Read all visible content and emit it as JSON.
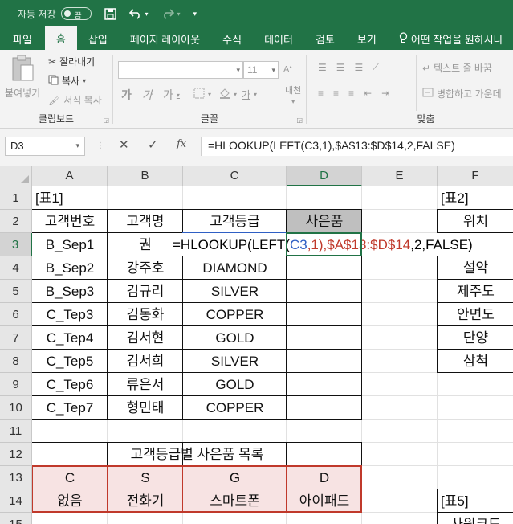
{
  "titlebar": {
    "autosave_label": "자동 저장",
    "autosave_state": "끔",
    "icons": [
      "save-icon",
      "undo-icon",
      "redo-icon",
      "customize-qat-icon"
    ]
  },
  "tabs": [
    "파일",
    "홈",
    "삽입",
    "페이지 레이아웃",
    "수식",
    "데이터",
    "검토",
    "보기"
  ],
  "active_tab": "홈",
  "tell_me": "어떤 작업을 원하시나",
  "ribbon": {
    "clipboard": {
      "paste": "붙여넣기",
      "cut": "잘라내기",
      "copy": "복사",
      "format_painter": "서식 복사",
      "group_label": "클립보드"
    },
    "font": {
      "font_name": "",
      "font_size": "11",
      "bold": "가",
      "italic": "가",
      "underline": "가",
      "phonetic": "내천",
      "group_label": "글꼴"
    },
    "alignment": {
      "wrap_text": "텍스트 줄 바꿈",
      "merge_center": "병합하고 가운데",
      "group_label": "맞춤"
    }
  },
  "formula_bar": {
    "name_box": "D3",
    "fx": "fx",
    "formula": "=HLOOKUP(LEFT(C3,1),$A$13:$D$14,2,FALSE)"
  },
  "columns": [
    "A",
    "B",
    "C",
    "D",
    "E",
    "F"
  ],
  "selected_column": "D",
  "rows": [
    "1",
    "2",
    "3",
    "4",
    "5",
    "6",
    "7",
    "8",
    "9",
    "10",
    "11",
    "12",
    "13",
    "14",
    "15"
  ],
  "selected_row": "3",
  "cells": {
    "A1": "[표1]",
    "F1": "[표2]",
    "A2": "고객번호",
    "B2": "고객명",
    "C2": "고객등급",
    "D2": "사은품",
    "F2": "위치",
    "A3": "B_Sep1",
    "B3": "권",
    "A4": "B_Sep2",
    "B4": "강주호",
    "C4": "DIAMOND",
    "F4": "설악",
    "A5": "B_Sep3",
    "B5": "김규리",
    "C5": "SILVER",
    "F5": "제주도",
    "A6": "C_Tep3",
    "B6": "김동화",
    "C6": "COPPER",
    "F6": "안면도",
    "A7": "C_Tep4",
    "B7": "김서현",
    "C7": "GOLD",
    "F7": "단양",
    "A8": "C_Tep5",
    "B8": "김서희",
    "C8": "SILVER",
    "F8": "삼척",
    "A9": "C_Tep6",
    "B9": "류은서",
    "C9": "GOLD",
    "A10": "C_Tep7",
    "B10": "형민태",
    "C10": "COPPER",
    "A12": "고객등급별 사은품 목록",
    "A13": "C",
    "B13": "S",
    "C13": "G",
    "D13": "D",
    "A14": "없음",
    "B14": "전화기",
    "C14": "스마트폰",
    "D14": "아이패드",
    "F14": "[표5]",
    "F15": "사원코드"
  },
  "edit_formula": {
    "p1": "=HLOOKUP(LEFT(",
    "ref1": "C3",
    "p2": ",1),",
    "ref2": "$A$13:$D$14",
    "p3": ",2,FALSE)"
  },
  "colors": {
    "excel_green": "#217346",
    "header_fill": "#bfbfbf",
    "lookup_fill": "#f7e3e3",
    "ref_blue": "#2f5fc4",
    "ref_red": "#c0392b"
  }
}
